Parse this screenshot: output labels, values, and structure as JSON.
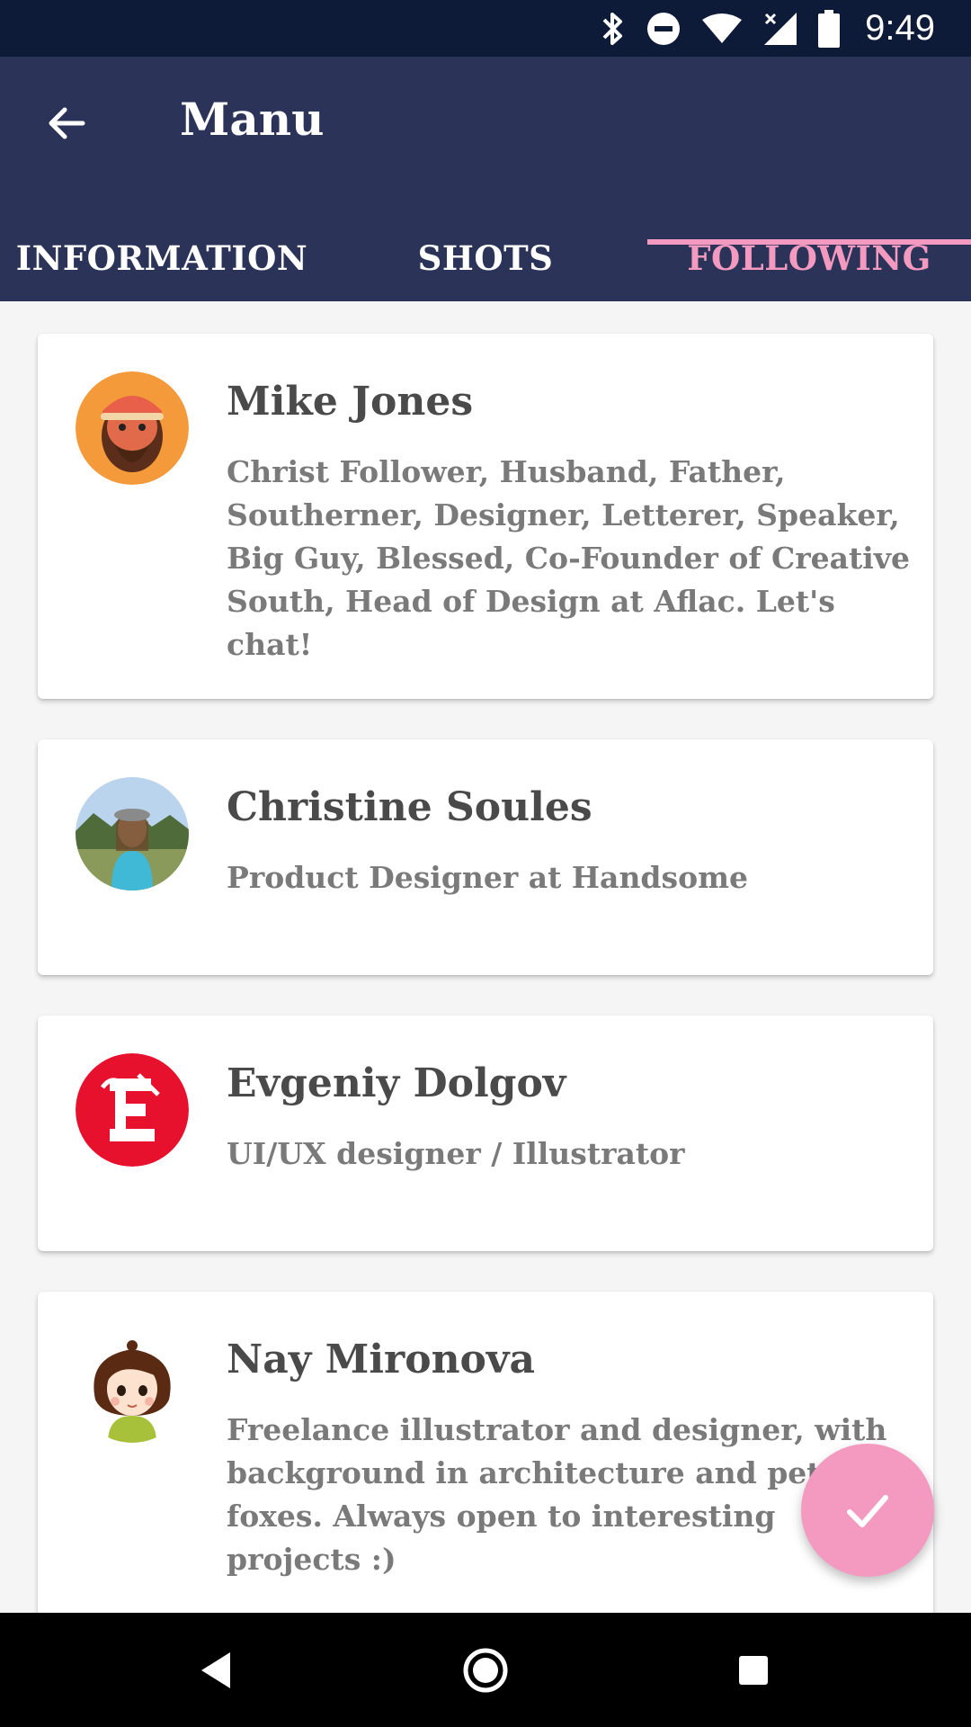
{
  "status_bar": {
    "time": "9:49"
  },
  "app_bar": {
    "title": "Manu"
  },
  "tabs": [
    {
      "label": "INFORMATION",
      "active": false
    },
    {
      "label": "SHOTS",
      "active": false
    },
    {
      "label": "FOLLOWING",
      "active": true
    }
  ],
  "following": [
    {
      "name": "Mike Jones",
      "bio": "Christ Follower, Husband, Father, Southerner, Designer, Letterer, Speaker, Big Guy, Blessed, Co-Founder of Creative South, Head of Design at Aflac. Let's chat!"
    },
    {
      "name": "Christine Soules",
      "bio": "Product Designer at Handsome"
    },
    {
      "name": "Evgeniy Dolgov",
      "bio": "UI/UX designer / Illustrator"
    },
    {
      "name": "Nay Mironova",
      "bio": "Freelance illustrator and designer, with background in architecture and petting foxes. Always open to interesting projects :)"
    }
  ],
  "colors": {
    "accent": "#f49ac0",
    "app_bar": "#2b3358",
    "status_bar": "#0d1a38"
  },
  "icons": {
    "back": "arrow-left-icon",
    "fab": "check-icon",
    "nav": [
      "back-triangle-icon",
      "home-circle-icon",
      "recents-square-icon"
    ]
  }
}
